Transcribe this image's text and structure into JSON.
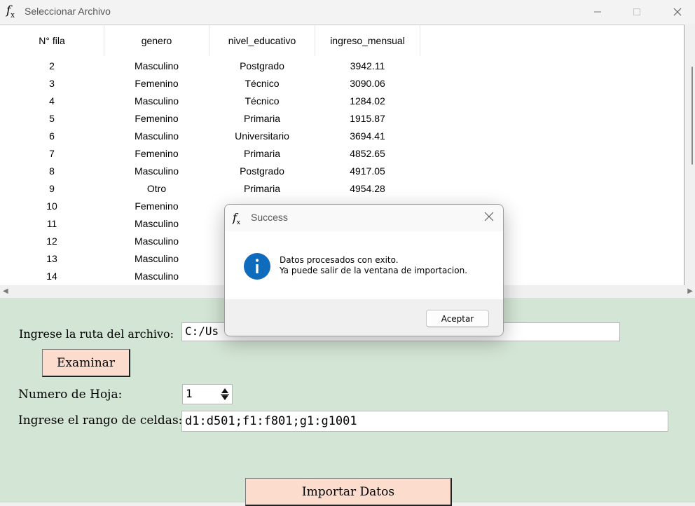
{
  "window": {
    "title": "Seleccionar Archivo",
    "icon": "function-icon",
    "controls": [
      "minimize",
      "maximize",
      "close"
    ]
  },
  "table": {
    "columns": [
      "N° fila",
      "genero",
      "nivel_educativo",
      "ingreso_mensual"
    ],
    "rows": [
      [
        "2",
        "Masculino",
        "Postgrado",
        "3942.11"
      ],
      [
        "3",
        "Femenino",
        "Técnico",
        "3090.06"
      ],
      [
        "4",
        "Masculino",
        "Técnico",
        "1284.02"
      ],
      [
        "5",
        "Femenino",
        "Primaria",
        "1915.87"
      ],
      [
        "6",
        "Masculino",
        "Universitario",
        "3694.41"
      ],
      [
        "7",
        "Femenino",
        "Primaria",
        "4852.65"
      ],
      [
        "8",
        "Masculino",
        "Postgrado",
        "4917.05"
      ],
      [
        "9",
        "Otro",
        "Primaria",
        "4954.28"
      ],
      [
        "10",
        "Femenino",
        "",
        ""
      ],
      [
        "11",
        "Masculino",
        "",
        ""
      ],
      [
        "12",
        "Masculino",
        "",
        ""
      ],
      [
        "13",
        "Masculino",
        "",
        ""
      ],
      [
        "14",
        "Masculino",
        "",
        ""
      ]
    ]
  },
  "form": {
    "path_label": "Ingrese la ruta del archivo:",
    "path_value": "C:/Us",
    "browse_button": "Examinar",
    "sheet_label": "Numero de Hoja:",
    "sheet_value": "1",
    "range_label": "Ingrese el rango de celdas:",
    "range_value": "d1:d501;f1:f801;g1:g1001",
    "import_button": "Importar Datos"
  },
  "dialog": {
    "title": "Success",
    "message_line1": "Datos procesados con exito.",
    "message_line2": "Ya puede salir de la ventana de importacion.",
    "ok_button": "Aceptar",
    "icon": "info-icon"
  },
  "colors": {
    "form_background": "#d3e5d4",
    "button_background": "#fcdccc",
    "info_icon": "#0f6cbd"
  }
}
